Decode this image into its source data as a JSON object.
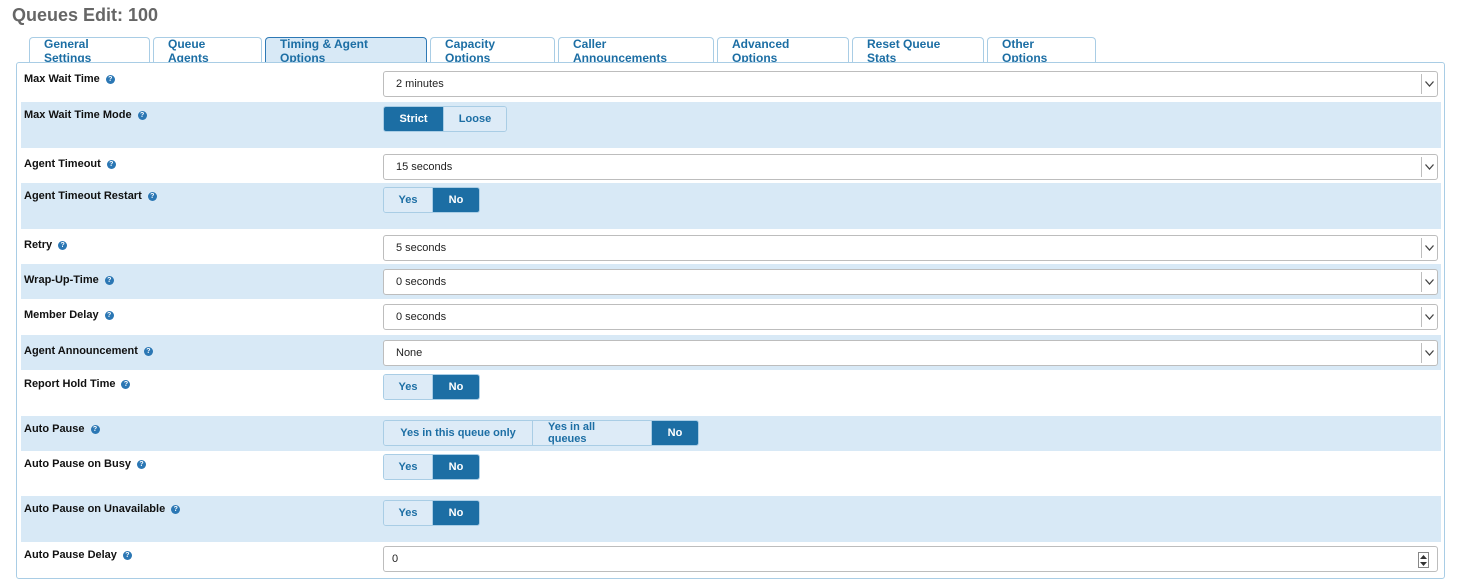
{
  "page": {
    "title": "Queues Edit: 100"
  },
  "tabs": [
    {
      "label": "General Settings",
      "active": false
    },
    {
      "label": "Queue Agents",
      "active": false
    },
    {
      "label": "Timing & Agent Options",
      "active": true
    },
    {
      "label": "Capacity Options",
      "active": false
    },
    {
      "label": "Caller Announcements",
      "active": false
    },
    {
      "label": "Advanced Options",
      "active": false
    },
    {
      "label": "Reset Queue Stats",
      "active": false
    },
    {
      "label": "Other Options",
      "active": false
    }
  ],
  "fields": {
    "max_wait_time": {
      "label": "Max Wait Time",
      "value": "2 minutes"
    },
    "max_wait_time_mode": {
      "label": "Max Wait Time Mode",
      "options": [
        "Strict",
        "Loose"
      ],
      "selected": "Strict"
    },
    "agent_timeout": {
      "label": "Agent Timeout",
      "value": "15 seconds"
    },
    "agent_timeout_restart": {
      "label": "Agent Timeout Restart",
      "options": [
        "Yes",
        "No"
      ],
      "selected": "No"
    },
    "retry": {
      "label": "Retry",
      "value": "5 seconds"
    },
    "wrap_up_time": {
      "label": "Wrap-Up-Time",
      "value": "0 seconds"
    },
    "member_delay": {
      "label": "Member Delay",
      "value": "0 seconds"
    },
    "agent_announcement": {
      "label": "Agent Announcement",
      "value": "None"
    },
    "report_hold_time": {
      "label": "Report Hold Time",
      "options": [
        "Yes",
        "No"
      ],
      "selected": "No"
    },
    "auto_pause": {
      "label": "Auto Pause",
      "options": [
        "Yes in this queue only",
        "Yes in all queues",
        "No"
      ],
      "selected": "No"
    },
    "auto_pause_busy": {
      "label": "Auto Pause on Busy",
      "options": [
        "Yes",
        "No"
      ],
      "selected": "No"
    },
    "auto_pause_unavailable": {
      "label": "Auto Pause on Unavailable",
      "options": [
        "Yes",
        "No"
      ],
      "selected": "No"
    },
    "auto_pause_delay": {
      "label": "Auto Pause Delay",
      "value": "0"
    }
  },
  "icons": {
    "help": "question-circle-icon",
    "dropdown": "chevron-down-icon",
    "spinner": "spinner-arrows-icon"
  },
  "colors": {
    "accent": "#1c6ea4",
    "row_alt": "#d8e9f6",
    "title": "#666666"
  }
}
